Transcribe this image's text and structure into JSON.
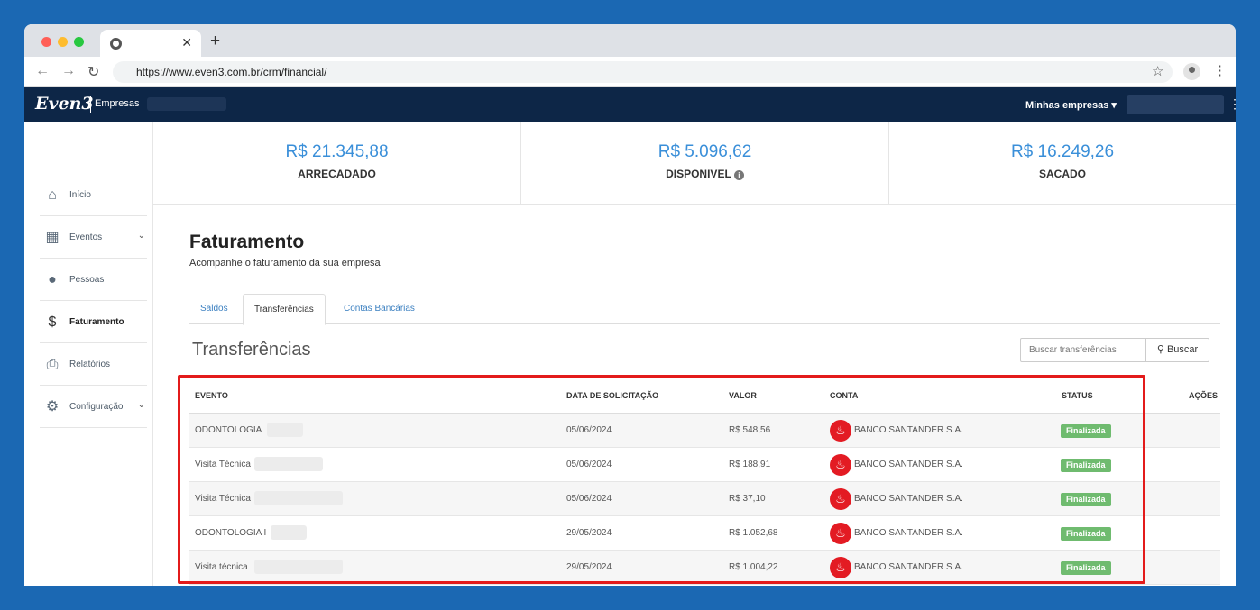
{
  "browser": {
    "url": "https://www.even3.com.br/crm/financial/",
    "dot_colors": [
      "#ff5f57",
      "#febc2e",
      "#28c840"
    ]
  },
  "header": {
    "logo": "Even3",
    "section": "Empresas",
    "companies_menu": "Minhas empresas ▾"
  },
  "sidebar": {
    "items": [
      {
        "label": "Início",
        "icon": "home-icon"
      },
      {
        "label": "Eventos",
        "icon": "calendar-icon"
      },
      {
        "label": "Pessoas",
        "icon": "person-icon"
      },
      {
        "label": "Faturamento",
        "icon": "money-bag-icon"
      },
      {
        "label": "Relatórios",
        "icon": "printer-icon"
      },
      {
        "label": "Configuração",
        "icon": "gears-icon"
      }
    ]
  },
  "stats": [
    {
      "value": "R$ 21.345,88",
      "label": "ARRECADADO"
    },
    {
      "value": "R$ 5.096,62",
      "label": "DISPONIVEL"
    },
    {
      "value": "R$ 16.249,26",
      "label": "SACADO"
    }
  ],
  "page": {
    "title": "Faturamento",
    "subtitle": "Acompanhe o faturamento da sua empresa",
    "tabs": [
      "Saldos",
      "Transferências",
      "Contas Bancárias"
    ],
    "section_title": "Transferências",
    "search_placeholder": "Buscar transferências",
    "search_button": "Buscar"
  },
  "table": {
    "columns": [
      "EVENTO",
      "DATA DE SOLICITAÇÃO",
      "VALOR",
      "CONTA",
      "STATUS",
      "AÇÕES"
    ],
    "rows": [
      {
        "event": "ODONTOLOGIA",
        "date": "05/06/2024",
        "value": "R$ 548,56",
        "account": "BANCO SANTANDER S.A.",
        "status": "Finalizada"
      },
      {
        "event": "Visita Técnica",
        "date": "05/06/2024",
        "value": "R$ 188,91",
        "account": "BANCO SANTANDER S.A.",
        "status": "Finalizada"
      },
      {
        "event": "Visita Técnica",
        "date": "05/06/2024",
        "value": "R$ 37,10",
        "account": "BANCO SANTANDER S.A.",
        "status": "Finalizada"
      },
      {
        "event": "ODONTOLOGIA I",
        "date": "29/05/2024",
        "value": "R$ 1.052,68",
        "account": "BANCO SANTANDER S.A.",
        "status": "Finalizada"
      },
      {
        "event": "Visita técnica",
        "date": "29/05/2024",
        "value": "R$ 1.004,22",
        "account": "BANCO SANTANDER S.A.",
        "status": "Finalizada"
      }
    ]
  },
  "colors": {
    "page_bg": "#1b68b3",
    "header_bg": "#0d2647",
    "accent": "#3a8fd9",
    "status_green": "#6fbb6f",
    "bank_red": "#e31b23",
    "highlight_red": "#e31b1b"
  }
}
